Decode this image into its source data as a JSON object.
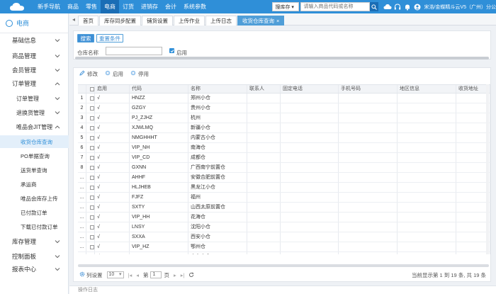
{
  "topnav": {
    "items": [
      {
        "label": "新手导航",
        "active": false
      },
      {
        "label": "商品",
        "active": false
      },
      {
        "label": "零售",
        "active": false
      },
      {
        "label": "电商",
        "active": true
      },
      {
        "label": "订货",
        "active": false
      },
      {
        "label": "进销存",
        "active": false
      },
      {
        "label": "会计",
        "active": false
      },
      {
        "label": "系统参数",
        "active": false
      }
    ],
    "stock_select": "搜库存",
    "search_placeholder": "请输入商品代码或名称",
    "company": "宋浩/金蝶精斗云V5（广州）分公"
  },
  "sidebar": {
    "header": "电商",
    "items": [
      {
        "label": "基础信息",
        "level": 1,
        "chevron": "down"
      },
      {
        "label": "商品管理",
        "level": 1,
        "chevron": "down"
      },
      {
        "label": "会员管理",
        "level": 1,
        "chevron": "down"
      },
      {
        "label": "订单管理",
        "level": 1,
        "chevron": "up"
      },
      {
        "label": "订单管理",
        "level": 2,
        "chevron": "down"
      },
      {
        "label": "退换货管理",
        "level": 2,
        "chevron": "down"
      },
      {
        "label": "唯品会JIT管理",
        "level": 2,
        "chevron": "up"
      },
      {
        "label": "收货仓库查询",
        "level": 3,
        "active": true
      },
      {
        "label": "PO单据查询",
        "level": 3
      },
      {
        "label": "送货单查询",
        "level": 3
      },
      {
        "label": "承运商",
        "level": 3
      },
      {
        "label": "唯品会库存上传",
        "level": 3
      },
      {
        "label": "已付款订单",
        "level": 3
      },
      {
        "label": "下载已付款订单",
        "level": 3
      },
      {
        "label": "库存管理",
        "level": 1,
        "chevron": "down"
      },
      {
        "label": "控制面板",
        "level": 1,
        "chevron": "down"
      },
      {
        "label": "报表中心",
        "level": 1,
        "chevron": "down"
      }
    ]
  },
  "tabs": [
    {
      "label": "首页",
      "active": false
    },
    {
      "label": "库存同步配置",
      "active": false
    },
    {
      "label": "铺货设置",
      "active": false
    },
    {
      "label": "上传作业",
      "active": false
    },
    {
      "label": "上传日志",
      "active": false
    },
    {
      "label": "收货仓库查询",
      "active": true
    }
  ],
  "search": {
    "search_btn": "搜索",
    "reset_btn": "重置条件",
    "warehouse_label": "仓库名称",
    "warehouse_value": "",
    "enabled_label": "启用"
  },
  "toolbar": {
    "edit": "修改",
    "enable": "启用",
    "disable": "停用"
  },
  "columns": [
    "启用",
    "代码",
    "名称",
    "联系人",
    "固定电话",
    "手机号码",
    "地区信息",
    "收货地址"
  ],
  "rows": [
    {
      "num": "1",
      "enabled": "√",
      "code": "HNZZ",
      "name": "郑州小仓"
    },
    {
      "num": "2",
      "enabled": "√",
      "code": "GZGY",
      "name": "贵州小仓"
    },
    {
      "num": "3",
      "enabled": "√",
      "code": "PJ_ZJHZ",
      "name": "杭州"
    },
    {
      "num": "4",
      "enabled": "√",
      "code": "XJWLMQ",
      "name": "新疆小仓"
    },
    {
      "num": "5",
      "enabled": "√",
      "code": "NMGHHHT",
      "name": "内蒙古小仓"
    },
    {
      "num": "6",
      "enabled": "√",
      "code": "VIP_NH",
      "name": "南海仓"
    },
    {
      "num": "7",
      "enabled": "√",
      "code": "VIP_CD",
      "name": "成都仓"
    },
    {
      "num": "8",
      "enabled": "√",
      "code": "GXNN",
      "name": "广西南宁前置仓"
    },
    {
      "num": "...",
      "enabled": "√",
      "code": "AHHF",
      "name": "安徽合肥前置仓"
    },
    {
      "num": "...",
      "enabled": "√",
      "code": "HLJHEB",
      "name": "黑龙江小仓"
    },
    {
      "num": "...",
      "enabled": "√",
      "code": "FJFZ",
      "name": "福州"
    },
    {
      "num": "...",
      "enabled": "√",
      "code": "SXTY",
      "name": "山西太原前置仓"
    },
    {
      "num": "...",
      "enabled": "√",
      "code": "VIP_HH",
      "name": "花海仓"
    },
    {
      "num": "...",
      "enabled": "√",
      "code": "LNSY",
      "name": "沈阳小仓"
    },
    {
      "num": "...",
      "enabled": "√",
      "code": "SXXA",
      "name": "西安小仓"
    },
    {
      "num": "...",
      "enabled": "√",
      "code": "VIP_HZ",
      "name": "鄂州仓"
    },
    {
      "num": "...",
      "enabled": "√",
      "code": "SDJN",
      "name": "山东小仓"
    }
  ],
  "pager": {
    "settings": "列设置",
    "page_size": "10",
    "page_prefix": "第",
    "page_value": "1",
    "page_suffix": "页",
    "summary": "当前显示第 1 到 19 条, 共 19 条"
  },
  "footer": "操作日志",
  "colors": {
    "primary": "#2f8fd8",
    "active_bg": "#e3effa"
  }
}
